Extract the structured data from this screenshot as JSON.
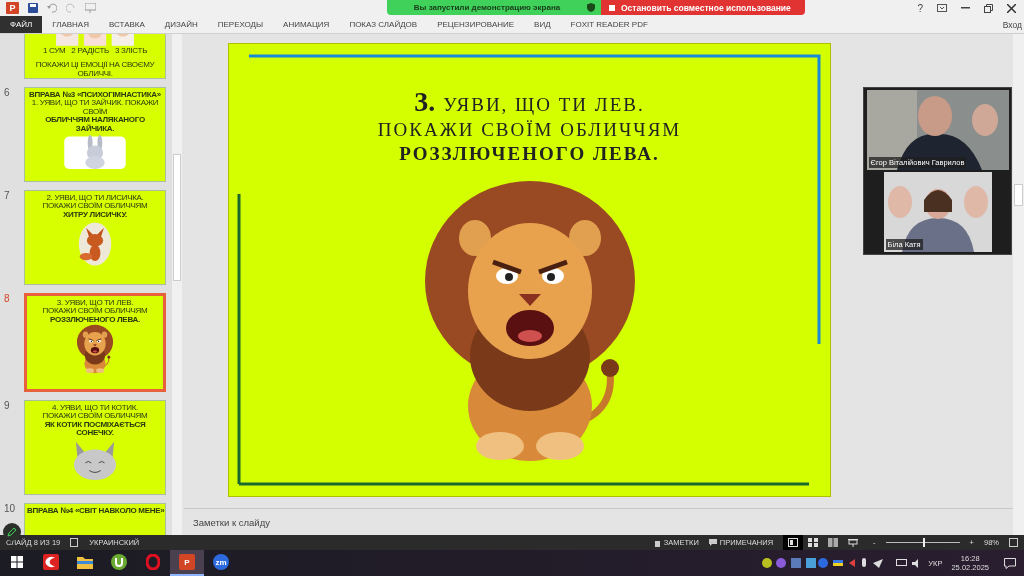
{
  "title_bar": {
    "app_badge": "P",
    "help": "?"
  },
  "share_banner": {
    "notice": "Вы запустили демонстрацию экрана",
    "stop_button": "Остановить совместное использование"
  },
  "ribbon_tabs": [
    {
      "label": "ФАЙЛ",
      "selected": true
    },
    {
      "label": "ГЛАВНАЯ",
      "selected": false
    },
    {
      "label": "ВСТАВКА",
      "selected": false
    },
    {
      "label": "ДИЗАЙН",
      "selected": false
    },
    {
      "label": "ПЕРЕХОДЫ",
      "selected": false
    },
    {
      "label": "АНИМАЦИЯ",
      "selected": false
    },
    {
      "label": "ПОКАЗ СЛАЙДОВ",
      "selected": false
    },
    {
      "label": "РЕЦЕНЗИРОВАНИЕ",
      "selected": false
    },
    {
      "label": "ВИД",
      "selected": false
    },
    {
      "label": "FOXIT READER PDF",
      "selected": false
    }
  ],
  "sign_in": "Вход",
  "slides": [
    {
      "kind": "emotions",
      "selected": false,
      "captions": [
        "1 СУМ",
        "2 РАДІСТЬ",
        "3 ЗЛІСТЬ"
      ],
      "lines": [
        "ПОКАЖИ ЦІ ЕМОЦІЇ НА СВОЄМУ ОБЛИЧЧІ."
      ]
    },
    {
      "kind": "bunny",
      "number": "6",
      "selected": false,
      "heading": "ВПРАВА №3 «ПСИХОГІМНАСТИКА»",
      "lines": [
        "1. УЯВИ, ЩО ТИ ЗАЙЧИК. ПОКАЖИ СВОЇМ",
        "ОБЛИЧЧЯМ НАЛЯКАНОГО ЗАЙЧИКА."
      ]
    },
    {
      "kind": "fox",
      "number": "7",
      "selected": false,
      "lines": [
        "2. УЯВИ, ЩО ТИ ЛИСИЧКА.",
        "ПОКАЖИ СВОЇМ ОБЛИЧЧЯМ",
        "ХИТРУ ЛИСИЧКУ."
      ]
    },
    {
      "kind": "lion",
      "number": "8",
      "selected": true,
      "lines": [
        "3. УЯВИ, ЩО ТИ ЛЕВ.",
        "ПОКАЖИ СВОЇМ ОБЛИЧЧЯМ",
        "РОЗЗЛЮЧЕНОГО ЛЕВА."
      ]
    },
    {
      "kind": "cat",
      "number": "9",
      "selected": false,
      "lines": [
        "4. УЯВИ, ЩО ТИ КОТИК.",
        "ПОКАЖИ СВОЇМ ОБЛИЧЧЯМ",
        "ЯК КОТИК ПОСМІХАЄТЬСЯ СОНЕЧКУ."
      ]
    },
    {
      "kind": "heading",
      "number": "10",
      "selected": false,
      "heading": "ВПРАВА №4 «СВІТ НАВКОЛО МЕНЕ»"
    }
  ],
  "current_slide": {
    "number": "3.",
    "lines": [
      {
        "text": "УЯВИ, ЩО ТИ ЛЕВ.",
        "bold": false
      },
      {
        "text": "ПОКАЖИ СВОЇМ ОБЛИЧЧЯМ",
        "bold": false
      },
      {
        "text": "РОЗЗЛЮЧЕНОГО ЛЕВА.",
        "bold": true
      }
    ]
  },
  "notes_placeholder": "Заметки к слайду",
  "video_tiles": [
    {
      "name": "Єгор Віталійович Гаврилов",
      "kind": "wide"
    },
    {
      "name": "Біла Катя",
      "kind": "narrow"
    }
  ],
  "status_bar": {
    "slide_info": "СЛАЙД 8 ИЗ 19",
    "language": "УКРАИНСКИЙ",
    "notes": "ЗАМЕТКИ",
    "comments": "ПРИМЕЧАНИЯ",
    "views": [
      {
        "kind": "normal",
        "selected": true
      },
      {
        "kind": "sorter",
        "selected": false
      },
      {
        "kind": "reading",
        "selected": false
      },
      {
        "kind": "show",
        "selected": false
      }
    ],
    "zoom_minus": "-",
    "zoom_plus": "+",
    "level": 0.5,
    "zoom": "98%"
  },
  "taskbar": {
    "apps": [
      {
        "kind": "start",
        "active": false
      },
      {
        "kind": "crescent",
        "active": false
      },
      {
        "kind": "folder",
        "active": false
      },
      {
        "kind": "torrent",
        "active": false
      },
      {
        "kind": "ring",
        "active": false
      },
      {
        "kind": "powerpoint",
        "label": "P",
        "active": true
      },
      {
        "kind": "zoom",
        "label": "zm",
        "active": false
      }
    ],
    "language": "УКР",
    "time": "16:28",
    "date": "25.02.2025"
  }
}
